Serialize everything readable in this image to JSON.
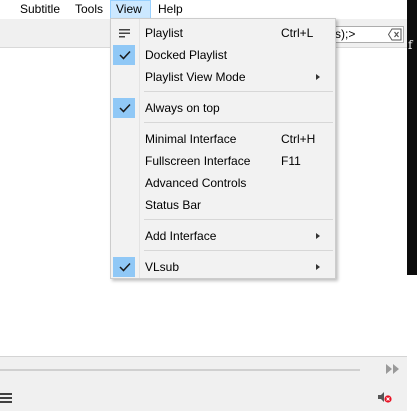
{
  "menubar": {
    "items": [
      {
        "label": "Subtitle"
      },
      {
        "label": "Tools"
      },
      {
        "label": "View"
      },
      {
        "label": "Help"
      }
    ]
  },
  "search": {
    "value": "s);>"
  },
  "view_menu": {
    "items": [
      {
        "label": "Playlist",
        "shortcut": "Ctrl+L",
        "icon": "playlist-lines-icon"
      },
      {
        "label": "Docked Playlist",
        "checked": true
      },
      {
        "label": "Playlist View Mode",
        "submenu": true
      },
      {
        "label": "Always on top",
        "checked": true
      },
      {
        "label": "Minimal Interface",
        "shortcut": "Ctrl+H"
      },
      {
        "label": "Fullscreen Interface",
        "shortcut": "F11"
      },
      {
        "label": "Advanced Controls"
      },
      {
        "label": "Status Bar"
      },
      {
        "label": "Add Interface",
        "submenu": true
      },
      {
        "label": "VLsub",
        "checked": true,
        "submenu": true
      }
    ]
  },
  "colors": {
    "menu_highlight": "#cce8ff",
    "check_bg": "#90c8f6"
  }
}
